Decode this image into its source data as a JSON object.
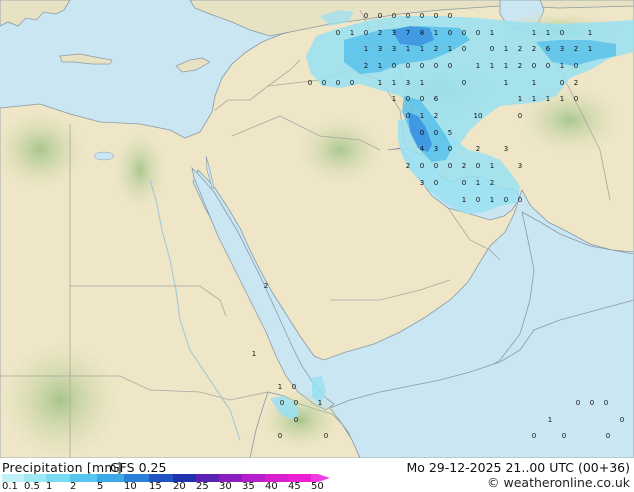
{
  "map": {
    "colors": {
      "sea": "#c9e6f2",
      "land": "#efe6c8",
      "green": "#b5cf9a",
      "coast": "#8a9aa4",
      "border": "#a8a8a0",
      "precip_light": "#99e0f2",
      "precip_mid": "#58c1ea",
      "precip_heavy": "#3a8ee0"
    },
    "precip_values": [
      "0",
      "0",
      "0",
      "0",
      "0",
      "0",
      "0",
      "0",
      "1",
      "0",
      "2",
      "3",
      "7",
      "8",
      "1",
      "0",
      "0",
      "0",
      "1",
      "1",
      "1",
      "0",
      "1",
      "1",
      "3",
      "3",
      "1",
      "1",
      "2",
      "1",
      "0",
      "0",
      "1",
      "2",
      "2",
      "6",
      "3",
      "2",
      "1",
      "2",
      "1",
      "0",
      "0",
      "0",
      "0",
      "0",
      "1",
      "1",
      "1",
      "2",
      "0",
      "0",
      "1",
      "0",
      "0",
      "0",
      "0",
      "0",
      "1",
      "1",
      "3",
      "1",
      "0",
      "1",
      "1",
      "0",
      "2",
      "1",
      "0",
      "0",
      "6",
      "1",
      "1",
      "1",
      "1",
      "0",
      "0",
      "1",
      "2",
      "10",
      "0",
      "0",
      "0",
      "5",
      "4",
      "3",
      "0",
      "2",
      "3",
      "2",
      "0",
      "0",
      "0",
      "2",
      "0",
      "1",
      "3",
      "3",
      "0",
      "0",
      "1",
      "2",
      "1",
      "0",
      "1",
      "0",
      "0",
      "2",
      "1",
      "1",
      "0",
      "0",
      "0",
      "1",
      "0",
      "0",
      "0",
      "0",
      "1",
      "0",
      "0",
      "0",
      "0",
      "0",
      "0",
      "0",
      "0"
    ]
  },
  "legend": {
    "label": "Precipitation [mm]",
    "model": "GFS 0.25",
    "datetime": "Mo 29-12-2025 21..00 UTC (00+36)",
    "credit": "© weatheronline.co.uk",
    "ticks": [
      "0.1",
      "0.5",
      "1",
      "2",
      "5",
      "10",
      "15",
      "20",
      "25",
      "30",
      "35",
      "40",
      "45",
      "50"
    ],
    "colors": [
      "#c2f2f9",
      "#9ee8f6",
      "#7ad9f3",
      "#56c6ee",
      "#3aa9e6",
      "#2a7fd8",
      "#2253c4",
      "#1f31ae",
      "#5a22b5",
      "#8a1fc0",
      "#b51ecb",
      "#d81fcf",
      "#ea1fd6",
      "#f03ce2"
    ]
  }
}
